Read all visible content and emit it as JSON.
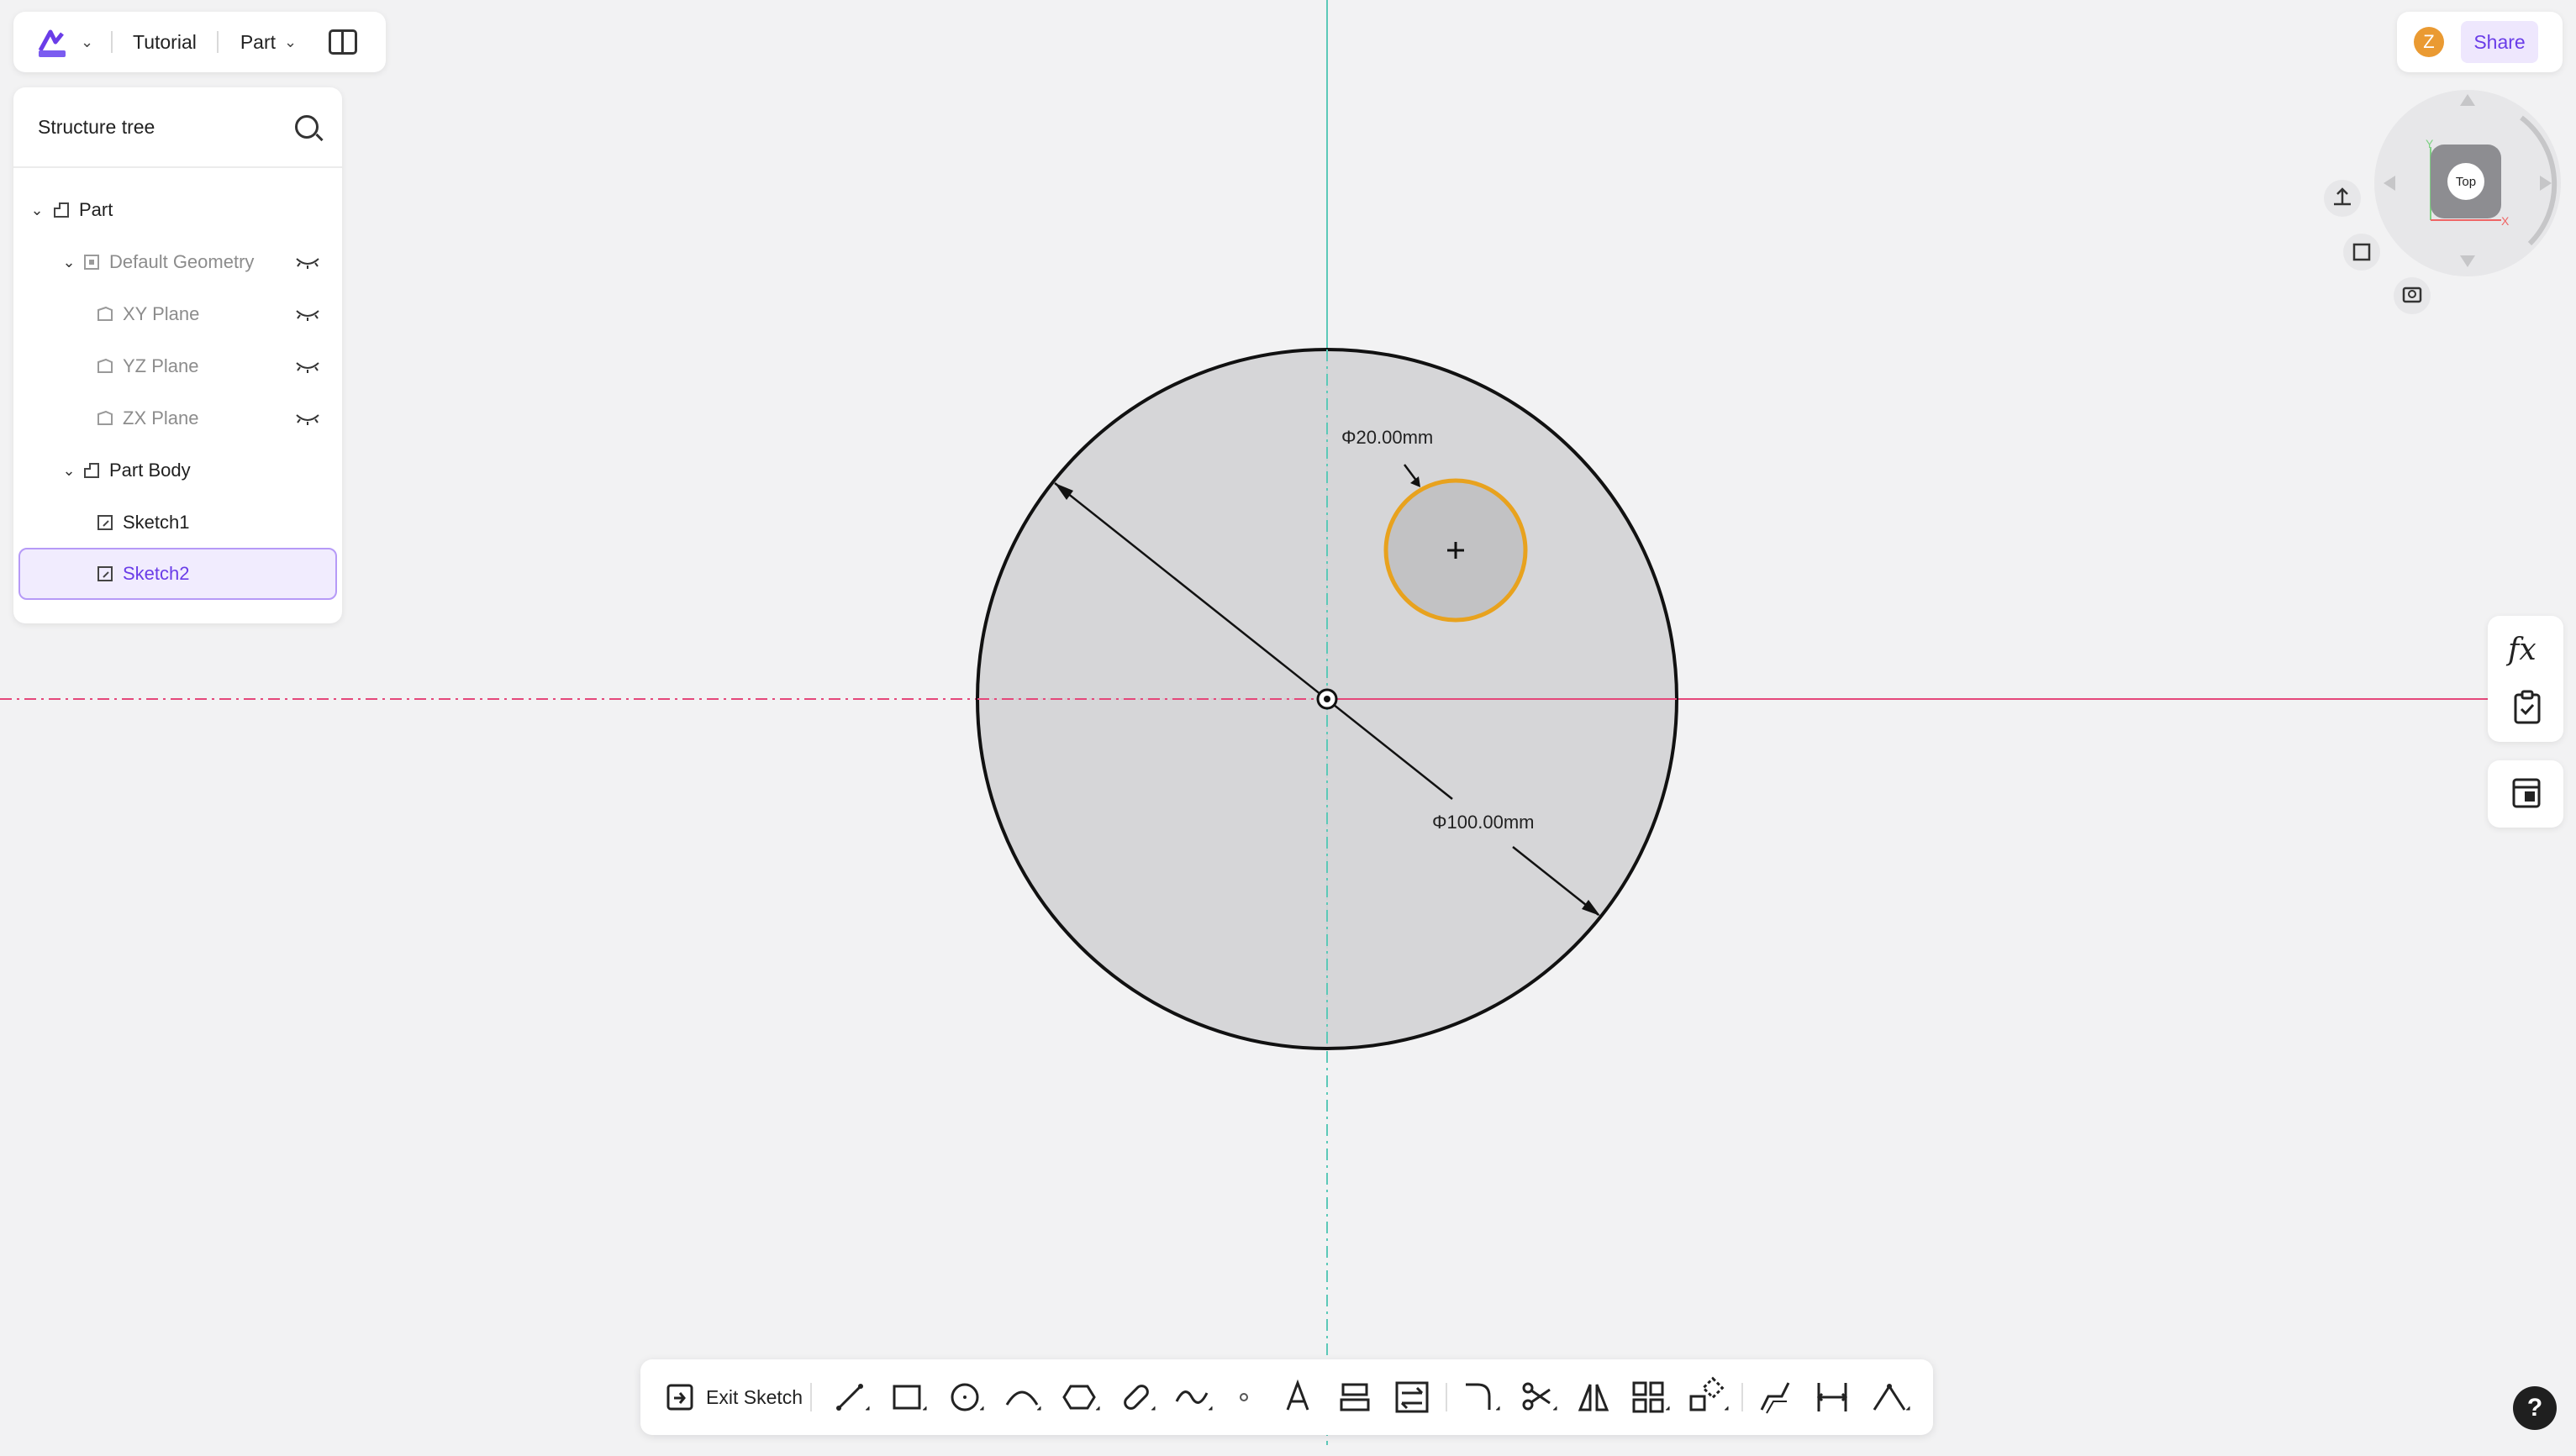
{
  "header": {
    "project_name": "Tutorial",
    "mode": "Part"
  },
  "structure_tree": {
    "title": "Structure tree",
    "items": [
      {
        "label": "Part",
        "expanded": true,
        "muted": false
      },
      {
        "label": "Default Geometry",
        "expanded": true,
        "muted": true
      },
      {
        "label": "XY Plane",
        "muted": true
      },
      {
        "label": "YZ Plane",
        "muted": true
      },
      {
        "label": "ZX Plane",
        "muted": true
      },
      {
        "label": "Part Body",
        "expanded": true,
        "muted": false
      },
      {
        "label": "Sketch1",
        "muted": false
      },
      {
        "label": "Sketch2",
        "muted": false,
        "selected": true
      }
    ]
  },
  "user": {
    "initial": "Z"
  },
  "share": {
    "label": "Share"
  },
  "view_cube": {
    "face": "Top",
    "axis_x": "X",
    "axis_y": "Y"
  },
  "sketch": {
    "outer_circle": {
      "diameter_label": "Φ100.00mm",
      "diameter_mm": 100
    },
    "inner_circle": {
      "diameter_label": "Φ20.00mm",
      "diameter_mm": 20,
      "highlight_color": "#e8a21e"
    }
  },
  "toolbar": {
    "exit_label": "Exit Sketch",
    "tools": [
      "line-tool-icon",
      "rectangle-tool-icon",
      "circle-tool-icon",
      "arc-tool-icon",
      "polygon-tool-icon",
      "slot-tool-icon",
      "spline-tool-icon",
      "point-tool-icon",
      "text-tool-icon",
      "project-tool-icon",
      "convert-tool-icon",
      "fillet-tool-icon",
      "trim-tool-icon",
      "mirror-tool-icon",
      "pattern-tool-icon",
      "transform-tool-icon",
      "offset-tool-icon",
      "dimension-tool-icon",
      "constraint-tool-icon"
    ]
  },
  "help": {
    "label": "?"
  },
  "colors": {
    "accent": "#6a3de8",
    "x_axis": "#e5487a",
    "y_axis": "#5cc9b8"
  }
}
